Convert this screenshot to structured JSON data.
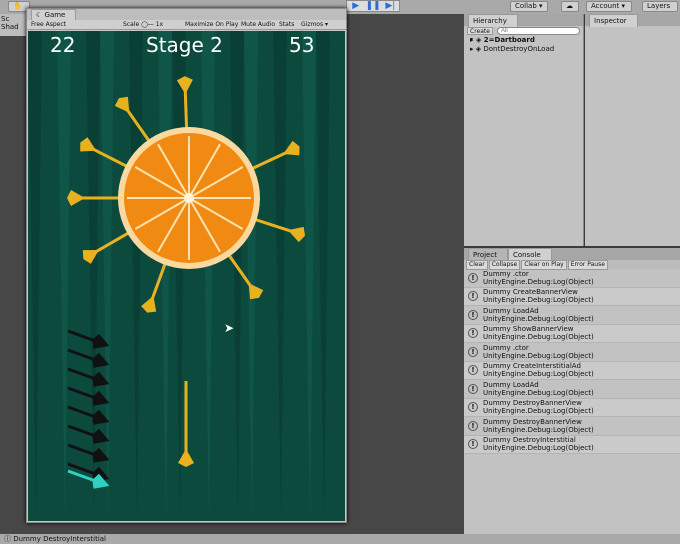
{
  "toolbar": {
    "collab": "Collab ▾",
    "account": "Account ▾",
    "layers": "Layers"
  },
  "scene": {
    "tab": "Sc",
    "shade": "Shad"
  },
  "game": {
    "tab": "Game",
    "aspect": "Free Aspect",
    "scale_label": "Scale",
    "scale_value": "1x",
    "maximize": "Maximize On Play",
    "mute": "Mute Audio",
    "stats": "Stats",
    "gizmos": "Gizmos ▾",
    "hud": {
      "score": "22",
      "stage": "Stage 2",
      "apples": "53"
    },
    "remaining_darts": 8,
    "colors": {
      "bg": "#0d4a3e",
      "dart": "#e8b21f",
      "orange": "#f18a12"
    }
  },
  "hierarchy": {
    "tab": "Hierarchy",
    "create": "Create ▾",
    "search_placeholder": "All",
    "items": [
      "2=Dartboard",
      "DontDestroyOnLoad"
    ]
  },
  "inspector": {
    "tab": "Inspector"
  },
  "console": {
    "tabs": [
      "Project",
      "Console"
    ],
    "buttons": [
      "Clear",
      "Collapse",
      "Clear on Play",
      "Error Pause"
    ],
    "logs": [
      [
        "Dummy .ctor",
        "UnityEngine.Debug:Log(Object)"
      ],
      [
        "Dummy CreateBannerView",
        "UnityEngine.Debug:Log(Object)"
      ],
      [
        "Dummy LoadAd",
        "UnityEngine.Debug:Log(Object)"
      ],
      [
        "Dummy ShowBannerView",
        "UnityEngine.Debug:Log(Object)"
      ],
      [
        "Dummy .ctor",
        "UnityEngine.Debug:Log(Object)"
      ],
      [
        "Dummy CreateInterstitialAd",
        "UnityEngine.Debug:Log(Object)"
      ],
      [
        "Dummy LoadAd",
        "UnityEngine.Debug:Log(Object)"
      ],
      [
        "Dummy DestroyBannerView",
        "UnityEngine.Debug:Log(Object)"
      ],
      [
        "Dummy DestroyBannerView",
        "UnityEngine.Debug:Log(Object)"
      ],
      [
        "Dummy DestroyInterstitial",
        "UnityEngine.Debug:Log(Object)"
      ]
    ]
  },
  "status": "Dummy DestroyInterstitial"
}
